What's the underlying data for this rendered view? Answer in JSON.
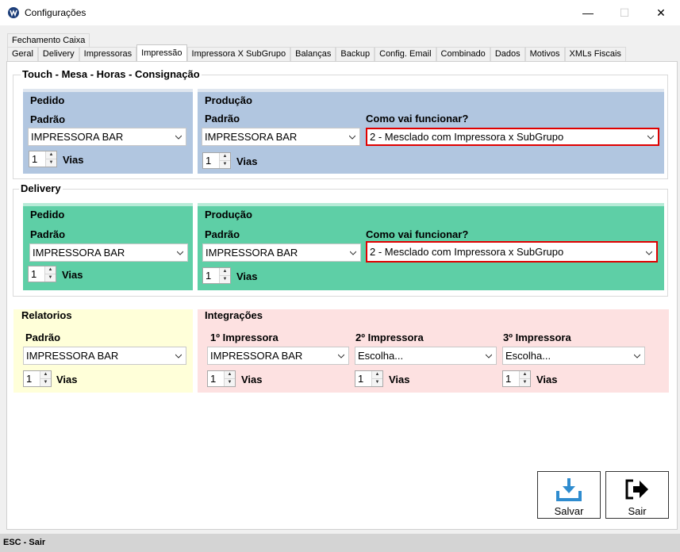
{
  "window": {
    "title": "Configurações",
    "min": "—",
    "max": "☐",
    "close": "✕"
  },
  "tabs": {
    "row2": [
      "Fechamento Caixa"
    ],
    "row1": [
      "Geral",
      "Delivery",
      "Impressoras",
      "Impressão",
      "Impressora X SubGrupo",
      "Balanças",
      "Backup",
      "Config. Email",
      "Combinado",
      "Dados",
      "Motivos",
      "XMLs Fiscais"
    ],
    "active": "Impressão"
  },
  "touch": {
    "title": "Touch - Mesa - Horas - Consignação",
    "pedido": {
      "title": "Pedido",
      "padrao_label": "Padrão",
      "padrao_value": "IMPRESSORA BAR",
      "vias_value": "1",
      "vias_label": "Vias"
    },
    "producao": {
      "title": "Produção",
      "padrao_label": "Padrão",
      "padrao_value": "IMPRESSORA BAR",
      "vias_value": "1",
      "vias_label": "Vias",
      "como_label": "Como vai funcionar?",
      "como_value": "2 - Mesclado com Impressora x SubGrupo"
    }
  },
  "delivery": {
    "title": "Delivery",
    "pedido": {
      "title": "Pedido",
      "padrao_label": "Padrão",
      "padrao_value": "IMPRESSORA BAR",
      "vias_value": "1",
      "vias_label": "Vias"
    },
    "producao": {
      "title": "Produção",
      "padrao_label": "Padrão",
      "padrao_value": "IMPRESSORA BAR",
      "vias_value": "1",
      "vias_label": "Vias",
      "como_label": "Como vai funcionar?",
      "como_value": "2 - Mesclado com Impressora x SubGrupo"
    }
  },
  "relatorios": {
    "title": "Relatorios",
    "padrao_label": "Padrão",
    "padrao_value": "IMPRESSORA BAR",
    "vias_value": "1",
    "vias_label": "Vias"
  },
  "integracoes": {
    "title": "Integrações",
    "imp1": {
      "label": "1º Impressora",
      "value": "IMPRESSORA BAR",
      "vias_value": "1",
      "vias_label": "Vias"
    },
    "imp2": {
      "label": "2º Impressora",
      "value": "Escolha...",
      "vias_value": "1",
      "vias_label": "Vias"
    },
    "imp3": {
      "label": "3º Impressora",
      "value": "Escolha...",
      "vias_value": "1",
      "vias_label": "Vias"
    }
  },
  "buttons": {
    "salvar": "Salvar",
    "sair": "Sair"
  },
  "status": "ESC - Sair",
  "colors": {
    "touch_group": "#b1c6e0",
    "delivery_group": "#5ecfa6",
    "relatorios_group": "#ffffd9",
    "integracoes_group": "#fde1e1",
    "highlight_border": "#e00000",
    "save_icon": "#2f8ccf"
  }
}
